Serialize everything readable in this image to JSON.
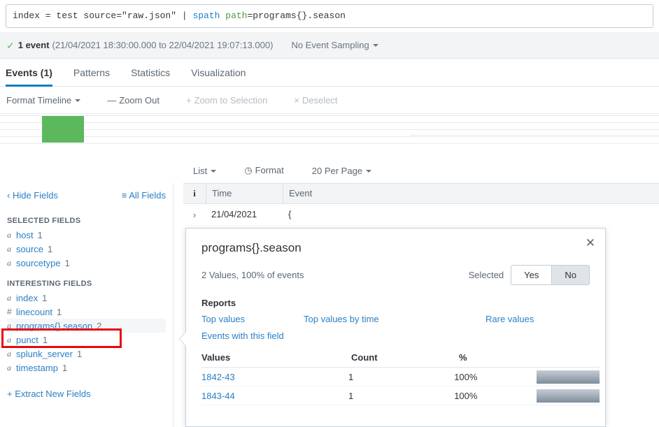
{
  "search": {
    "query_prefix": "index = test source=\"raw.json\" | ",
    "query_cmd": "spath",
    "query_mid": " ",
    "query_arg": "path",
    "query_suffix": "=programs{}.season"
  },
  "status": {
    "check_icon": "check-icon",
    "event_count": "1 event",
    "time_range": "(21/04/2021 18:30:00.000 to 22/04/2021 19:07:13.000)",
    "sampling": "No Event Sampling"
  },
  "tabs": [
    {
      "label": "Events (1)",
      "active": true
    },
    {
      "label": "Patterns",
      "active": false
    },
    {
      "label": "Statistics",
      "active": false
    },
    {
      "label": "Visualization",
      "active": false
    }
  ],
  "timeline_toolbar": {
    "format_timeline": "Format Timeline",
    "zoom_out_sym": "—",
    "zoom_out": "Zoom Out",
    "zoom_sel_sym": "+",
    "zoom_to_selection": "Zoom to Selection",
    "deselect_sym": "×",
    "deselect": "Deselect"
  },
  "list_controls": {
    "list": "List",
    "format": "Format",
    "per_page": "20 Per Page"
  },
  "sidebar": {
    "hide_fields": "Hide Fields",
    "all_fields": "All Fields",
    "selected_heading": "SELECTED FIELDS",
    "selected_fields": [
      {
        "type": "a",
        "name": "host",
        "count": "1"
      },
      {
        "type": "a",
        "name": "source",
        "count": "1"
      },
      {
        "type": "a",
        "name": "sourcetype",
        "count": "1"
      }
    ],
    "interesting_heading": "INTERESTING FIELDS",
    "interesting_fields": [
      {
        "type": "a",
        "name": "index",
        "count": "1",
        "highlighted": false
      },
      {
        "type": "#",
        "name": "linecount",
        "count": "1",
        "highlighted": false
      },
      {
        "type": "a",
        "name": "programs{}.season",
        "count": "2",
        "highlighted": true
      },
      {
        "type": "a",
        "name": "punct",
        "count": "1",
        "highlighted": false
      },
      {
        "type": "a",
        "name": "splunk_server",
        "count": "1",
        "highlighted": false
      },
      {
        "type": "a",
        "name": "timestamp",
        "count": "1",
        "highlighted": false
      }
    ],
    "extract_new_fields": "+ Extract New Fields"
  },
  "events_table": {
    "columns": {
      "info": "i",
      "time": "Time",
      "event": "Event"
    },
    "rows": [
      {
        "expander": "›",
        "time": "21/04/2021",
        "event": "{"
      }
    ]
  },
  "popup": {
    "title": "programs{}.season",
    "close_icon": "close-icon",
    "summary": "2 Values, 100% of events",
    "selected_label": "Selected",
    "selected_yes": "Yes",
    "selected_no": "No",
    "selected_value": "No",
    "reports_heading": "Reports",
    "report_links": [
      "Top values",
      "Top values by time",
      "Rare values",
      "Events with this field"
    ],
    "values_columns": {
      "values": "Values",
      "count": "Count",
      "percent": "%"
    },
    "values_rows": [
      {
        "value": "1842-43",
        "count": "1",
        "percent": "100%",
        "bar_pct": 100
      },
      {
        "value": "1843-44",
        "count": "1",
        "percent": "100%",
        "bar_pct": 100
      }
    ]
  },
  "colors": {
    "accent_blue": "#0c7dbd",
    "link_blue": "#2b7fc4",
    "timeline_green": "#5cb85c",
    "annotation_red": "#e8090c",
    "strip_gray": "#f2f4f5"
  },
  "chart_data": {
    "type": "bar",
    "title": "",
    "categories": [
      "21/04/2021 18:30"
    ],
    "values": [
      1
    ],
    "xlabel": "",
    "ylabel": "",
    "ylim": [
      0,
      1
    ],
    "grid": true,
    "legend": "none",
    "series": [
      {
        "name": "events",
        "values": [
          1
        ]
      }
    ]
  }
}
